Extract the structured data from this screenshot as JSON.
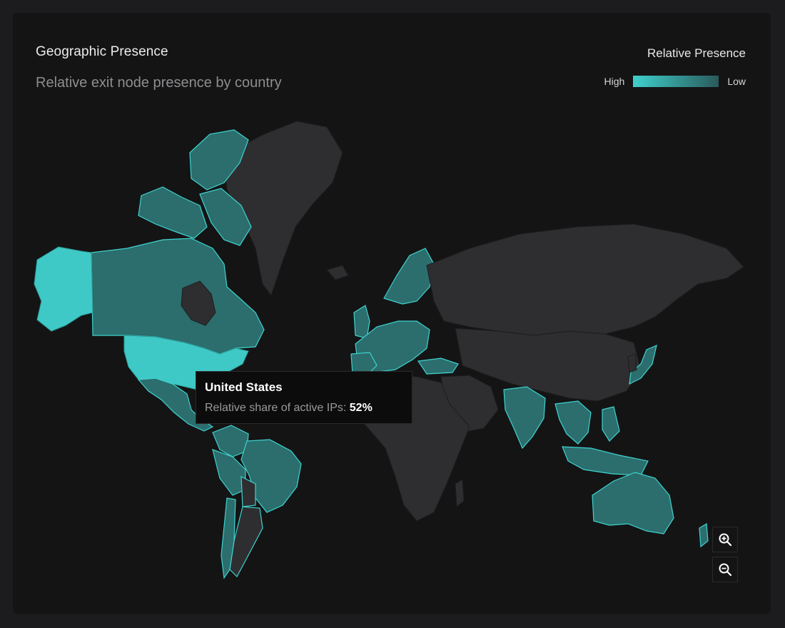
{
  "header": {
    "title": "Geographic Presence",
    "subtitle": "Relative exit node presence by country"
  },
  "legend": {
    "title": "Relative Presence",
    "high_label": "High",
    "low_label": "Low",
    "color_high": "#3ed0cd",
    "color_low": "#2b5a5b"
  },
  "tooltip": {
    "country": "United States",
    "metric_label": "Relative share of active IPs: ",
    "metric_value": "52%"
  },
  "map": {
    "highlighted_countries": [
      {
        "name": "United States",
        "level": "high"
      },
      {
        "name": "Alaska",
        "level": "high"
      },
      {
        "name": "Canada",
        "level": "medium"
      },
      {
        "name": "Mexico",
        "level": "medium"
      },
      {
        "name": "Brazil",
        "level": "medium"
      },
      {
        "name": "Colombia",
        "level": "medium"
      },
      {
        "name": "Peru",
        "level": "medium"
      },
      {
        "name": "Chile",
        "level": "low"
      },
      {
        "name": "Argentina",
        "level": "low"
      },
      {
        "name": "Western Europe",
        "level": "medium"
      },
      {
        "name": "Scandinavia",
        "level": "medium"
      },
      {
        "name": "Turkey",
        "level": "medium"
      },
      {
        "name": "India",
        "level": "medium"
      },
      {
        "name": "Japan",
        "level": "medium"
      },
      {
        "name": "Southeast Asia",
        "level": "medium"
      },
      {
        "name": "Indonesia",
        "level": "medium"
      },
      {
        "name": "Australia",
        "level": "medium"
      },
      {
        "name": "New Zealand",
        "level": "low"
      }
    ],
    "colors": {
      "default_land": "#2e2e31",
      "high": "#3fc9c6",
      "medium": "#2b6e6d",
      "outline": "#3fd3cf"
    }
  },
  "controls": {
    "zoom_in_icon": "zoom-in-icon",
    "zoom_out_icon": "zoom-out-icon"
  }
}
